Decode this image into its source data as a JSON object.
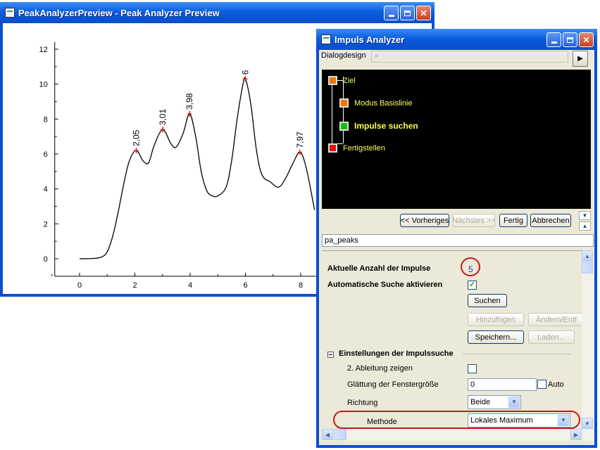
{
  "preview_window": {
    "title": "PeakAnalyzerPreview - Peak Analyzer Preview"
  },
  "chart_data": {
    "type": "line",
    "xlim": [
      -1,
      8.5
    ],
    "ylim": [
      -1,
      12.5
    ],
    "x_ticks": [
      "0",
      "2",
      "4",
      "6",
      "8"
    ],
    "y_ticks": [
      "0",
      "2",
      "4",
      "6",
      "8",
      "10",
      "12"
    ],
    "x": [
      0,
      0.5,
      0.8,
      1.0,
      1.2,
      1.4,
      1.6,
      1.8,
      2.05,
      2.3,
      2.5,
      2.7,
      3.01,
      3.3,
      3.5,
      3.75,
      3.98,
      4.2,
      4.4,
      4.6,
      4.8,
      5.0,
      5.3,
      5.5,
      5.7,
      5.9,
      6.0,
      6.2,
      6.4,
      6.6,
      6.9,
      7.2,
      7.45,
      7.7,
      7.97,
      8.2,
      8.5
    ],
    "y": [
      0,
      0.02,
      0.1,
      0.4,
      1.3,
      2.7,
      4.3,
      5.6,
      6.2,
      5.6,
      5.5,
      6.5,
      7.4,
      6.6,
      6.4,
      7.2,
      8.3,
      7.0,
      5.0,
      3.9,
      3.6,
      3.6,
      4.1,
      5.6,
      8.0,
      9.9,
      10.3,
      8.8,
      6.2,
      4.8,
      4.4,
      4.1,
      4.6,
      5.4,
      6.1,
      5.2,
      2.8
    ],
    "peaks": [
      {
        "x": 2.05,
        "y": 6.2,
        "label": "2,05"
      },
      {
        "x": 3.01,
        "y": 7.4,
        "label": "3,01"
      },
      {
        "x": 3.98,
        "y": 8.3,
        "label": "3,98"
      },
      {
        "x": 6.0,
        "y": 10.3,
        "label": "6"
      },
      {
        "x": 7.97,
        "y": 6.1,
        "label": "7,97"
      }
    ],
    "colors": {
      "line": "#000000",
      "peak_marker": "#e01010"
    }
  },
  "analyzer": {
    "title": "Impuls Analyzer",
    "dialog_design_label": "Dialogdesign",
    "dialog_design_value": "»",
    "steps": [
      {
        "label": "Ziel",
        "color": "#f07800"
      },
      {
        "label": "Modus Basislinie",
        "color": "#f07800"
      },
      {
        "label": "Impulse suchen",
        "color": "#10c010"
      },
      {
        "label": "Fertigstellen",
        "color": "#e81010"
      }
    ],
    "nav": {
      "prev": "<< Vorheriges",
      "next": "Nächstes >>",
      "finish": "Fertig",
      "cancel": "Abbrechen"
    },
    "theme_field": "pa_peaks",
    "settings": {
      "peak_count_label": "Aktuelle Anzahl der Impulse",
      "peak_count_value": "5",
      "auto_search_label": "Automatische Suche aktivieren",
      "auto_search_checked": "✓",
      "search_button": "Suchen",
      "add_button": "Hinzufügen",
      "modify_button": "Ändern/Entf",
      "save_button": "Speichern...",
      "load_button": "Laden...",
      "section_title": "Einstellungen der Impulssuche",
      "show_second_derivative_label": "2. Ableitung zeigen",
      "smoothing_label": "Glättung der Fenstergröße",
      "smoothing_value": "0",
      "auto_label": "Auto",
      "direction_label": "Richtung",
      "direction_value": "Beide",
      "method_label": "Methode",
      "method_value": "Lokales Maximum"
    }
  }
}
